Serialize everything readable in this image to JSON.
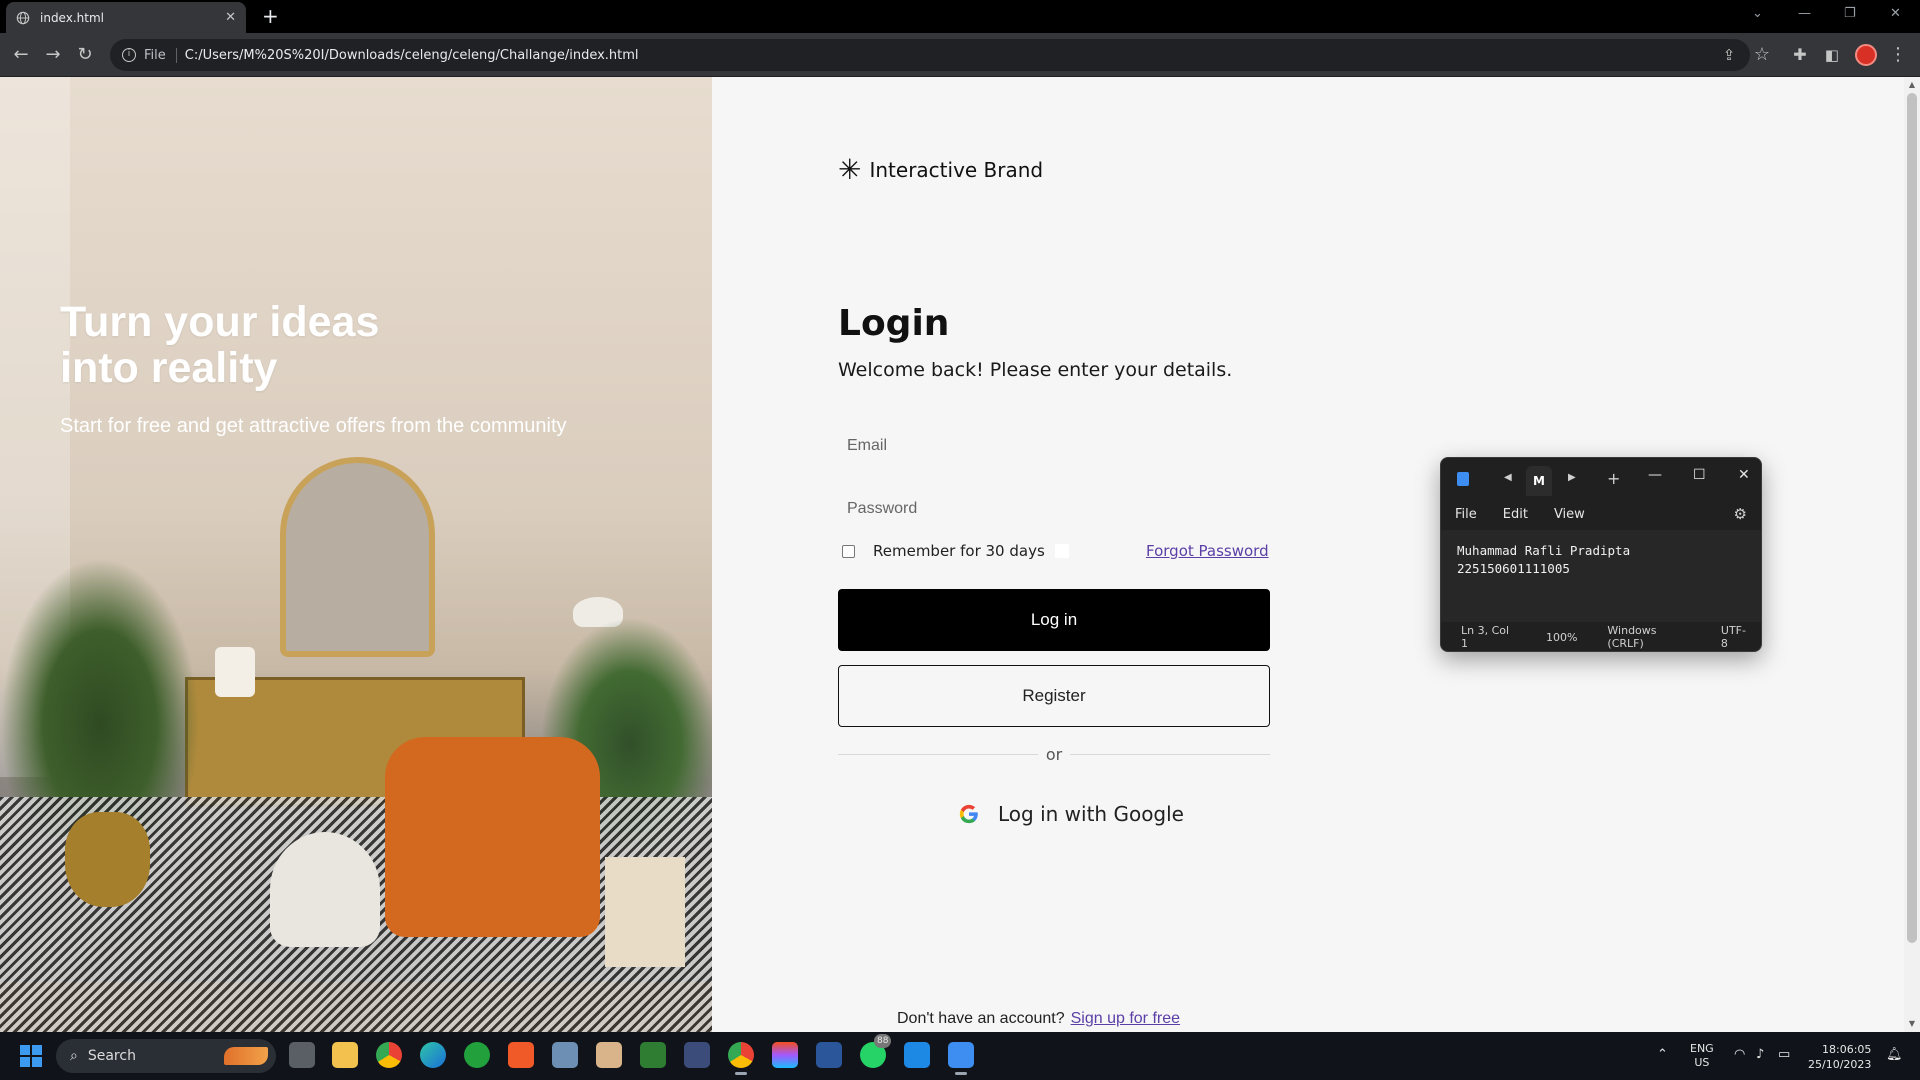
{
  "browser": {
    "tab_title": "index.html",
    "address_scheme_label": "File",
    "address": "C:/Users/M%20S%20I/Downloads/celeng/celeng/Challange/index.html"
  },
  "hero": {
    "title": "Turn your ideas\ninto reality",
    "subtitle": "Start for free and get attractive offers from the community"
  },
  "brand": {
    "name": "Interactive Brand",
    "mark": "✳"
  },
  "login": {
    "title": "Login",
    "subtitle": "Welcome back! Please enter your details.",
    "email_placeholder": "Email",
    "password_placeholder": "Password",
    "remember_label": "Remember for 30 days",
    "forgot_label": "Forgot Password",
    "login_button": "Log in",
    "register_button": "Register",
    "divider_text": "or",
    "google_button": "Log in with Google",
    "signup_prompt": "Don't have an account?",
    "signup_link": "Sign up for free"
  },
  "notepad": {
    "tab_label": "M",
    "menu": [
      "File",
      "Edit",
      "View"
    ],
    "content": "Muhammad Rafli Pradipta\n225150601111005",
    "status": [
      "Ln 3, Col 1",
      "100%",
      "Windows (CRLF)",
      "UTF-8"
    ]
  },
  "taskbar": {
    "search_placeholder": "Search",
    "lang_line1": "ENG",
    "lang_line2": "US",
    "time": "18:06:05",
    "date": "25/10/2023",
    "whatsapp_badge": "88"
  },
  "colors": {
    "accent_link": "#5b3fa6",
    "login_button_bg": "#000000",
    "page_bg": "#f6f6f6"
  }
}
